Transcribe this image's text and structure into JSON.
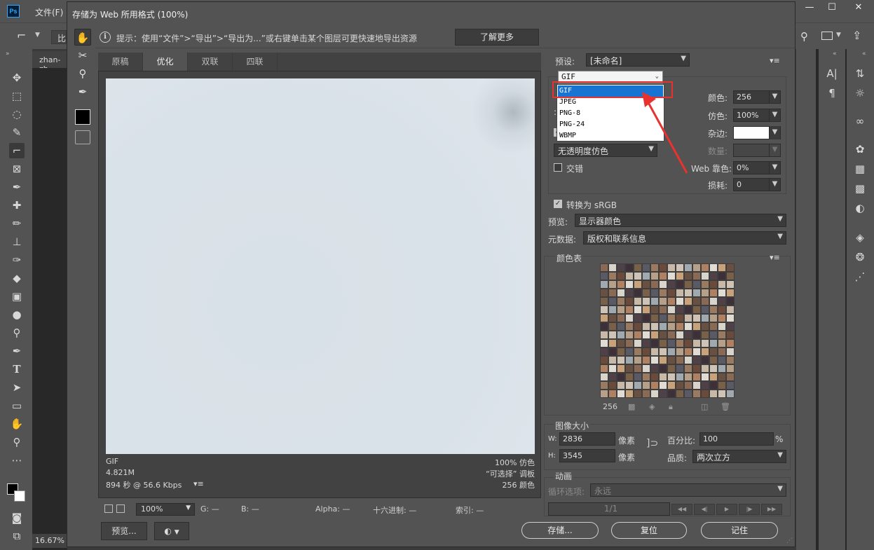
{
  "photoshop": {
    "menu_first": "文件(F)",
    "doc_tab": "zhan-zh",
    "zoom_status": "16.67%",
    "options_label": "比",
    "left_tools": [
      "move-tool",
      "marquee-tool",
      "lasso-tool",
      "quick-select-tool",
      "crop-tool",
      "frame-tool",
      "eyedropper-tool",
      "healing-tool",
      "brush-tool",
      "stamp-tool",
      "history-brush-tool",
      "eraser-tool",
      "gradient-tool",
      "blur-tool",
      "dodge-tool",
      "pen-tool",
      "type-tool",
      "path-select-tool",
      "shape-tool",
      "hand-tool",
      "zoom-tool",
      "more-tools"
    ],
    "type_tool_glyph": "T"
  },
  "dialog": {
    "title": "存储为 Web 所用格式 (100%)",
    "hint_icon": "i",
    "hint": "提示：使用“文件”>“导出”>“导出为...”或右键单击某个图层可更快速地导出资源",
    "learn_more": "了解更多",
    "tabs": [
      {
        "label": "原稿",
        "active": false
      },
      {
        "label": "优化",
        "active": true
      },
      {
        "label": "双联",
        "active": false
      },
      {
        "label": "四联",
        "active": false
      }
    ],
    "preview_info": {
      "format": "GIF",
      "size": "4.821M",
      "time": "894 秒 @ 56.6 Kbps",
      "dither": "100% 仿色",
      "palette": "“可选择” 调板",
      "colors": "256 颜色"
    },
    "bottom_bar": {
      "zoom": "100%",
      "g_label": "G: —",
      "b_label": "B: —",
      "alpha_label": "Alpha: —",
      "hex_label": "十六进制: —",
      "index_label": "索引: —"
    },
    "buttons": {
      "preview": "预览...",
      "save": "存储...",
      "reset": "复位",
      "remember": "记住"
    }
  },
  "settings": {
    "preset_label": "预设:",
    "preset_value": "[未命名]",
    "format_value": "GIF",
    "format_options": [
      "GIF",
      "JPEG",
      "PNG-8",
      "PNG-24",
      "WBMP"
    ],
    "colors_label": "颜色:",
    "colors_value": "256",
    "dither_label": "仿色:",
    "dither_value": "100%",
    "matte_label": "杂边:",
    "amount_label": "数量:",
    "web_snap_label": "Web 靠色:",
    "web_snap_value": "0%",
    "lossy_label": "损耗:",
    "lossy_value": "0",
    "transparency_dither": "无透明度仿色",
    "interlaced": "交错",
    "convert_srgb": "转换为 sRGB",
    "preview_label": "预览:",
    "preview_value": "显示器颜色",
    "metadata_label": "元数据:",
    "metadata_value": "版权和联系信息"
  },
  "color_table": {
    "title": "颜色表",
    "count": "256",
    "palette": [
      "#8a6a55",
      "#6b4a3a",
      "#c9a27a",
      "#5a5a66",
      "#b08060",
      "#3d3038",
      "#a0a8b0",
      "#d8d4cc",
      "#c8b8a8",
      "#6a5040",
      "#9a7a60",
      "#e0dcd4",
      "#7a6048",
      "#b8a088",
      "#504048",
      "#cfc3b5"
    ]
  },
  "image_size": {
    "title": "图像大小",
    "w_label": "W:",
    "w_value": "2836",
    "h_label": "H:",
    "h_value": "3545",
    "unit": "像素",
    "percent_label": "百分比:",
    "percent_value": "100",
    "percent_unit": "%",
    "quality_label": "品质:",
    "quality_value": "两次立方"
  },
  "animation": {
    "title": "动画",
    "loop_label": "循环选项:",
    "loop_value": "永远",
    "frame": "1/1"
  },
  "colors": {
    "accent_red": "#e8322f",
    "selection_blue": "#1874d2"
  }
}
